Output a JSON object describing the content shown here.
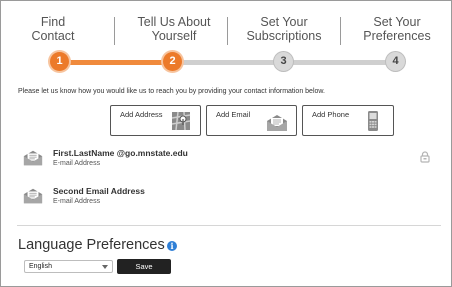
{
  "steps": [
    {
      "line1": "Find",
      "line2": "Contact",
      "number": "1",
      "state": "active"
    },
    {
      "line1": "Tell Us About",
      "line2": "Yourself",
      "number": "2",
      "state": "active"
    },
    {
      "line1": "Set Your",
      "line2": "Subscriptions",
      "number": "3",
      "state": "todo"
    },
    {
      "line1": "Set Your",
      "line2": "Preferences",
      "number": "4",
      "state": "todo"
    }
  ],
  "intro": "Please let us know how you would like us to reach you by providing your contact information below.",
  "add_buttons": {
    "address": {
      "label": "Add Address",
      "icon": "map-icon"
    },
    "email": {
      "label": "Add Email",
      "icon": "envelope-icon"
    },
    "phone": {
      "label": "Add Phone",
      "icon": "phone-icon"
    }
  },
  "emails": [
    {
      "address": "First.LastName @go.mnstate.edu",
      "type": "E-mail Address",
      "icon": "envelope-icon",
      "locked": true
    },
    {
      "address": "Second Email Address",
      "type": "E-mail Address",
      "icon": "envelope-icon",
      "locked": false
    }
  ],
  "language": {
    "title": "Language Preferences",
    "info_glyph": "i",
    "selected": "English",
    "save_label": "Save"
  },
  "colors": {
    "accent": "#ec7a2a",
    "inactive": "#d9d9d9",
    "save_bg": "#222222",
    "info": "#2f7fd6"
  }
}
